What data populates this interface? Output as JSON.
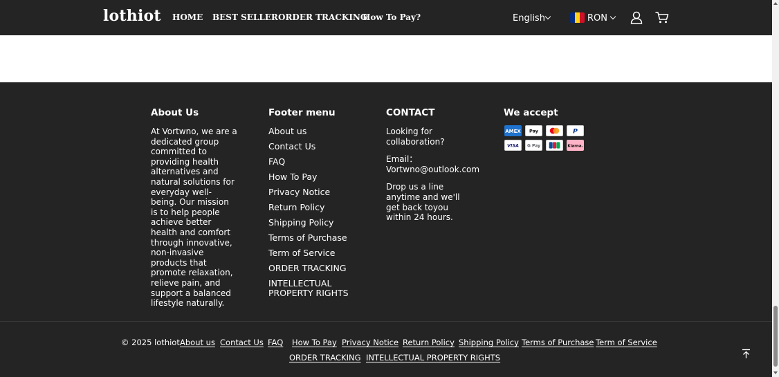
{
  "header": {
    "logo": "lothiot",
    "nav": [
      "HOME",
      "BEST SELLER",
      "ORDER TRACKING",
      "How To Pay?"
    ],
    "language": "English",
    "currency": "RON",
    "flag_colors": [
      "#002B7F",
      "#FCD116",
      "#CE1126"
    ],
    "icons": [
      "account-icon",
      "cart-icon"
    ]
  },
  "footer": {
    "about": {
      "title": "About Us",
      "text": "At Vortwno, we are a dedicated group committed to providing health alternatives and natural solutions for everyday well-being. Our mission is to help people achieve better health and comfort through innovative, non-invasive products that promote relaxation, relieve pain, and support a balanced lifestyle naturally."
    },
    "menu": {
      "title": "Footer menu",
      "items": [
        "About us",
        "Contact Us",
        "FAQ",
        "How To Pay",
        "Privacy Notice",
        "Return Policy",
        "Shipping Policy",
        "Terms of Purchase",
        "Term of Service",
        "ORDER TRACKING",
        "INTELLECTUAL PROPERTY RIGHTS"
      ]
    },
    "contact": {
      "title": "CONTACT",
      "lines": [
        "Looking for collaboration?",
        "Email： Vortwno@outlook.com",
        "Drop us a line anytime and we'll get back toyou within 24 hours."
      ]
    },
    "payments": {
      "title": "We accept",
      "methods": [
        "American Express",
        "Apple Pay",
        "Mastercard",
        "PayPal",
        "VISA",
        "G Pay",
        "JCB",
        "Klarna."
      ]
    },
    "bottom": {
      "copyright": "© 2025 lothiot",
      "links_row1": [
        "About us",
        "Contact Us",
        "FAQ",
        "How To Pay",
        "Privacy Notice",
        "Return Policy",
        "Shipping Policy",
        "Terms of Purchase",
        "Term of Service"
      ],
      "links_row2": [
        "ORDER TRACKING",
        "INTELLECTUAL PROPERTY RIGHTS"
      ]
    },
    "colors": {
      "background": "#242424",
      "text": "#ffffff"
    }
  }
}
